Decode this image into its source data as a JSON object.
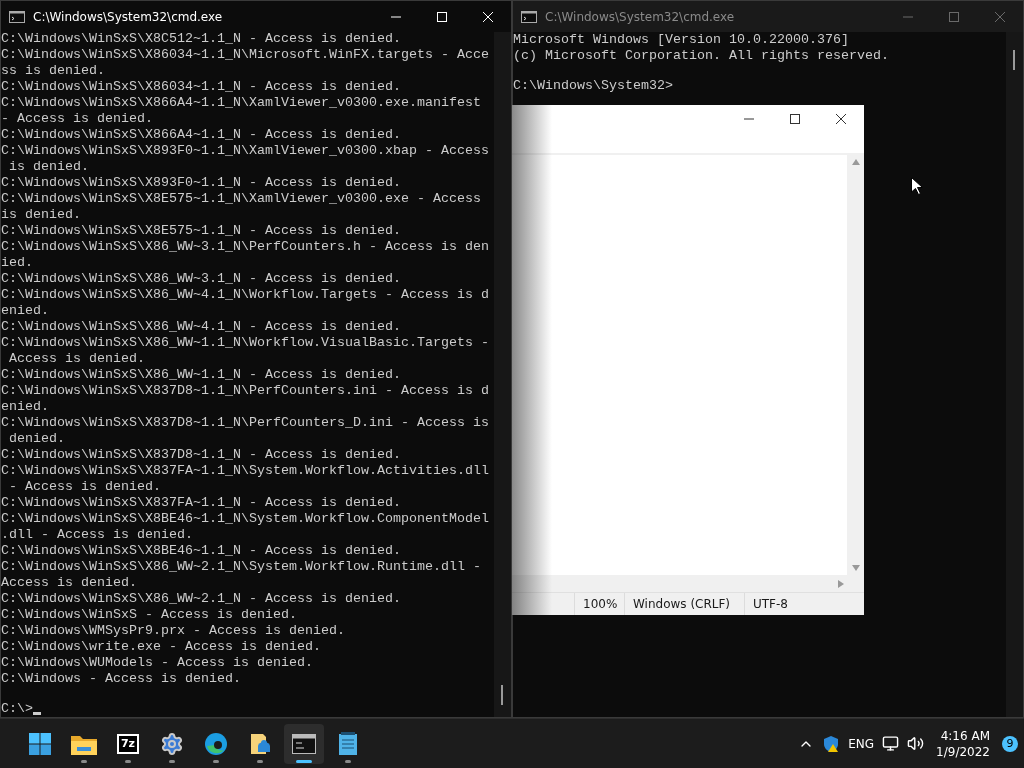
{
  "windows": [
    {
      "kind": "console",
      "title": "C:\\Windows\\System32\\cmd.exe",
      "active": true,
      "lines": [
        "C:\\Windows\\WinSxS\\X8C512~1.1_N - Access is denied.",
        "C:\\Windows\\WinSxS\\X86034~1.1_N\\Microsoft.WinFX.targets - Acce",
        "ss is denied.",
        "C:\\Windows\\WinSxS\\X86034~1.1_N - Access is denied.",
        "C:\\Windows\\WinSxS\\X866A4~1.1_N\\XamlViewer_v0300.exe.manifest",
        "- Access is denied.",
        "C:\\Windows\\WinSxS\\X866A4~1.1_N - Access is denied.",
        "C:\\Windows\\WinSxS\\X893F0~1.1_N\\XamlViewer_v0300.xbap - Access",
        " is denied.",
        "C:\\Windows\\WinSxS\\X893F0~1.1_N - Access is denied.",
        "C:\\Windows\\WinSxS\\X8E575~1.1_N\\XamlViewer_v0300.exe - Access",
        "is denied.",
        "C:\\Windows\\WinSxS\\X8E575~1.1_N - Access is denied.",
        "C:\\Windows\\WinSxS\\X86_WW~3.1_N\\PerfCounters.h - Access is den",
        "ied.",
        "C:\\Windows\\WinSxS\\X86_WW~3.1_N - Access is denied.",
        "C:\\Windows\\WinSxS\\X86_WW~4.1_N\\Workflow.Targets - Access is d",
        "enied.",
        "C:\\Windows\\WinSxS\\X86_WW~4.1_N - Access is denied.",
        "C:\\Windows\\WinSxS\\X86_WW~1.1_N\\Workflow.VisualBasic.Targets -",
        " Access is denied.",
        "C:\\Windows\\WinSxS\\X86_WW~1.1_N - Access is denied.",
        "C:\\Windows\\WinSxS\\X837D8~1.1_N\\PerfCounters.ini - Access is d",
        "enied.",
        "C:\\Windows\\WinSxS\\X837D8~1.1_N\\PerfCounters_D.ini - Access is",
        " denied.",
        "C:\\Windows\\WinSxS\\X837D8~1.1_N - Access is denied.",
        "C:\\Windows\\WinSxS\\X837FA~1.1_N\\System.Workflow.Activities.dll",
        " - Access is denied.",
        "C:\\Windows\\WinSxS\\X837FA~1.1_N - Access is denied.",
        "C:\\Windows\\WinSxS\\X8BE46~1.1_N\\System.Workflow.ComponentModel",
        ".dll - Access is denied.",
        "C:\\Windows\\WinSxS\\X8BE46~1.1_N - Access is denied.",
        "C:\\Windows\\WinSxS\\X86_WW~2.1_N\\System.Workflow.Runtime.dll -",
        "Access is denied.",
        "C:\\Windows\\WinSxS\\X86_WW~2.1_N - Access is denied.",
        "C:\\Windows\\WinSxS - Access is denied.",
        "C:\\Windows\\WMSysPr9.prx - Access is denied.",
        "C:\\Windows\\write.exe - Access is denied.",
        "C:\\Windows\\WUModels - Access is denied.",
        "C:\\Windows - Access is denied."
      ],
      "prompt": "C:\\>"
    },
    {
      "kind": "console",
      "title": "C:\\Windows\\System32\\cmd.exe",
      "active": false,
      "lines": [
        "Microsoft Windows [Version 10.0.22000.376]",
        "(c) Microsoft Corporation. All rights reserved."
      ],
      "prompt": "C:\\Windows\\System32>"
    },
    {
      "kind": "notepad",
      "status_bar": [
        "100%",
        "Windows (CRLF)",
        "UTF-8"
      ]
    }
  ],
  "taskbar": {
    "apps": [
      {
        "kind": "start",
        "running": false,
        "selected": false
      },
      {
        "kind": "folder",
        "running": true,
        "selected": false
      },
      {
        "kind": "archiver",
        "label": "7z",
        "running": true,
        "selected": false
      },
      {
        "kind": "settings",
        "running": true,
        "selected": false
      },
      {
        "kind": "browser",
        "running": true,
        "selected": false
      },
      {
        "kind": "files",
        "running": true,
        "selected": false
      },
      {
        "kind": "terminal",
        "running": true,
        "selected": true
      },
      {
        "kind": "notepad",
        "running": true,
        "selected": false
      }
    ],
    "tray": {
      "language": "ENG",
      "time": "4:16 AM",
      "date": "1/9/2022",
      "badge": "9"
    }
  }
}
